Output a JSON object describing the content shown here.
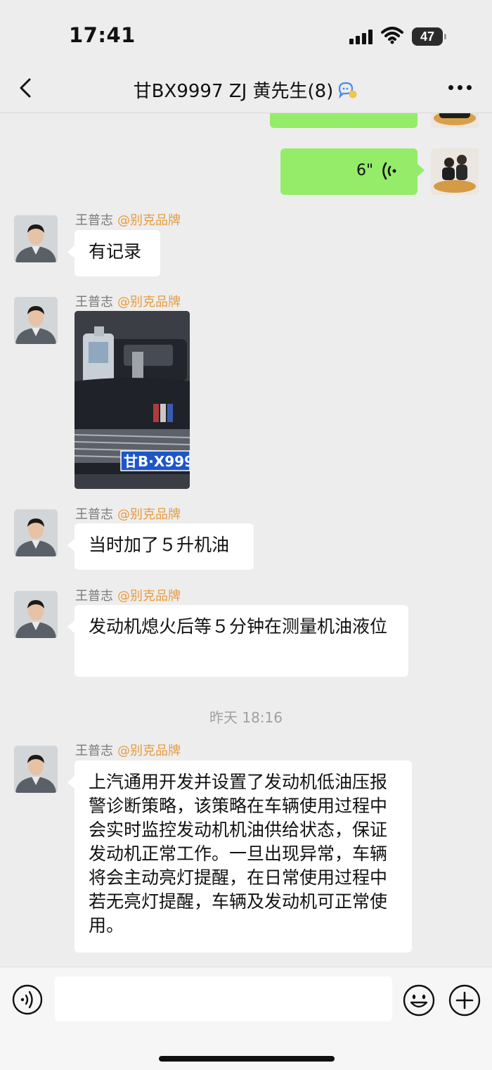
{
  "status_bar": {
    "time": "17:41",
    "battery": "47"
  },
  "nav": {
    "title": "甘BX9997  ZJ  黄先生(8)"
  },
  "messages": {
    "voice": {
      "duration": "6\""
    },
    "m1": {
      "sender": "王普志",
      "tag": "@别克品牌",
      "text": "有记录"
    },
    "m2": {
      "sender": "王普志",
      "tag": "@别克品牌",
      "plate": "甘B·X999"
    },
    "m3": {
      "sender": "王普志",
      "tag": "@别克品牌",
      "text": "当时加了５升机油"
    },
    "m4": {
      "sender": "王普志",
      "tag": "@别克品牌",
      "text": "发动机熄火后等５分钟在测量机油液位"
    },
    "timestamp": "昨天 18:16",
    "m5": {
      "sender": "王普志",
      "tag": "@别克品牌",
      "text": "上汽通用开发并设置了发动机低油压报警诊断策略，该策略在车辆使用过程中会实时监控发动机机油供给状态，保证发动机正常工作。一旦出现异常，车辆将会主动亮灯提醒，在日常使用过程中若无亮灯提醒，车辆及发动机可正常使用。"
    }
  },
  "input": {
    "placeholder": ""
  },
  "colors": {
    "my_bubble": "#95ec69",
    "other_bubble": "#ffffff",
    "background": "#ededed",
    "sender_tag": "#e89a3c"
  },
  "icons": [
    "back-icon",
    "group-badge-icon",
    "more-icon",
    "voice-icon",
    "voice-input-icon",
    "emoji-icon",
    "plus-icon",
    "signal-icon",
    "wifi-icon",
    "battery-icon"
  ]
}
